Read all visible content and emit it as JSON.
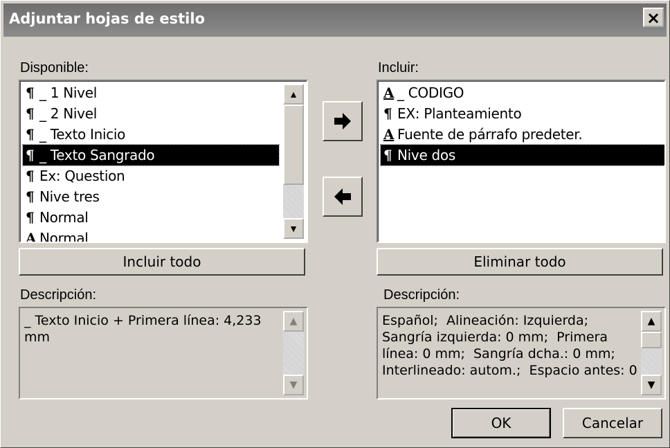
{
  "window": {
    "title": "Adjuntar hojas de estilo",
    "close_label": "×"
  },
  "available": {
    "label": "Disponible:",
    "items": [
      {
        "glyph": "¶",
        "text": "_ 1 Nivel"
      },
      {
        "glyph": "¶",
        "text": "_ 2 Nivel"
      },
      {
        "glyph": "¶",
        "text": "_ Texto Inicio"
      },
      {
        "glyph": "¶",
        "text": "_ Texto Sangrado"
      },
      {
        "glyph": "¶",
        "text": "Ex: Question"
      },
      {
        "glyph": "¶",
        "text": "Nive tres"
      },
      {
        "glyph": "¶",
        "text": "Normal"
      },
      {
        "glyph": "A",
        "text": "Normal"
      }
    ],
    "selected_index": 3
  },
  "include": {
    "label": "Incluir:",
    "items": [
      {
        "glyph": "A",
        "text": "_ CODIGO"
      },
      {
        "glyph": "¶",
        "text": "EX: Planteamiento"
      },
      {
        "glyph": "A",
        "text": "Fuente de párrafo predeter."
      },
      {
        "glyph": "¶",
        "text": "Nive dos"
      }
    ],
    "selected_index": 3
  },
  "buttons": {
    "add_arrow": "right-arrow-icon",
    "remove_arrow": "left-arrow-icon",
    "include_all": "Incluir todo",
    "remove_all": "Eliminar todo",
    "ok": "OK",
    "cancel": "Cancelar"
  },
  "left_description": {
    "label": "Descripción:",
    "text": "_ Texto Inicio + Primera línea: 4,233\nmm"
  },
  "right_description": {
    "label": "Descripción:",
    "text": "Español;  Alineación: Izquierda;\nSangría izquierda: 0 mm;  Primera\nlínea: 0 mm;  Sangría dcha.: 0 mm;\nInterlineado: autom.;  Espacio antes: 0"
  },
  "colors": {
    "face": "#d4d0c8",
    "title_bar": "#808080",
    "selection": "#000000"
  }
}
